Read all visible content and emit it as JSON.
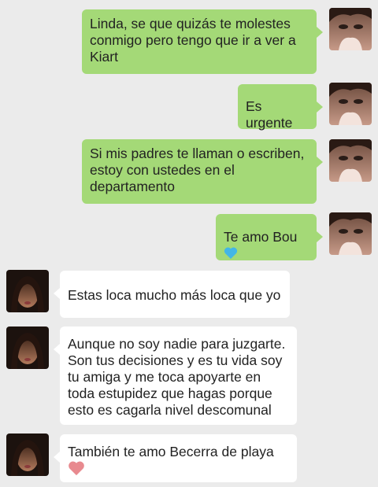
{
  "colors": {
    "background": "#ebebeb",
    "outgoing_bubble": "#a4d977",
    "incoming_bubble": "#ffffff"
  },
  "messages": [
    {
      "direction": "outgoing",
      "text": "Linda, se que quizás te molestes conmigo pero tengo que ir a ver a Kiart"
    },
    {
      "direction": "outgoing",
      "text": "Es urgente"
    },
    {
      "direction": "outgoing",
      "text": "Si mis padres te llaman o escriben, estoy con ustedes en el departamento"
    },
    {
      "direction": "outgoing",
      "text": "Te amo Bou",
      "emoji": "blue-heart-icon"
    },
    {
      "direction": "incoming",
      "text": "Estas loca mucho más loca que yo"
    },
    {
      "direction": "incoming",
      "text": "Aunque no soy nadie para juzgarte. Son tus decisiones y es tu vida soy tu amiga y me toca apoyarte en toda estupidez que hagas porque esto es cagarla nivel descomunal"
    },
    {
      "direction": "incoming",
      "text": "También te amo Becerra de playa",
      "emoji": "pink-heart-icon"
    }
  ]
}
